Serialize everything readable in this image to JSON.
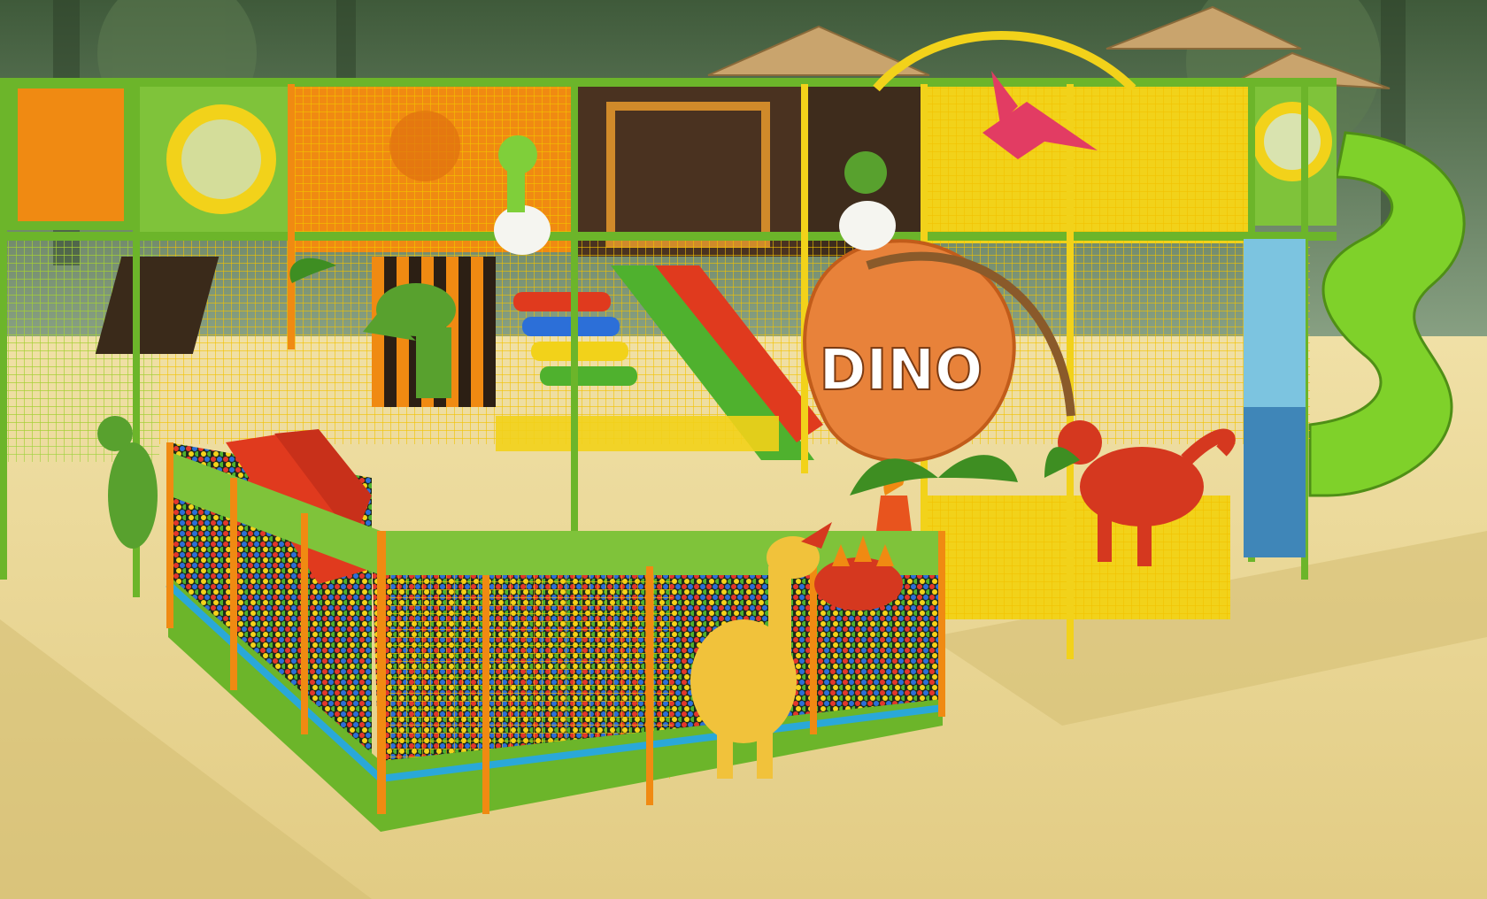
{
  "scene": {
    "sign_text": "DINO"
  },
  "colors": {
    "floor": "#e9d99a",
    "floor_shadow": "#d3bd72",
    "mural_dark": "#3f5a3a",
    "mural_light": "#8fa78a",
    "frame_green": "#6cb52a",
    "frame_orange": "#f08a12",
    "frame_yellow": "#f2d21a",
    "panel_red": "#e03a1e",
    "net": "#f2c200",
    "roof": "#c9a46d",
    "slide_green": "#7fd12a",
    "ball_red": "#e4362b",
    "ball_blue": "#2c6fd8",
    "ball_yellow": "#f5d21a",
    "ball_green": "#4fb12e",
    "sign_panel": "#e8823a",
    "sign_text": "#ffffff",
    "dino_yellow": "#f1c23b",
    "dino_red": "#d5381f",
    "dino_green": "#58a12e",
    "pterodactyl": "#e23c63"
  },
  "icons": {
    "tube_slide": "spiral-tube-slide",
    "ball_pit": "ball-pit",
    "sign": "dino-sign"
  }
}
